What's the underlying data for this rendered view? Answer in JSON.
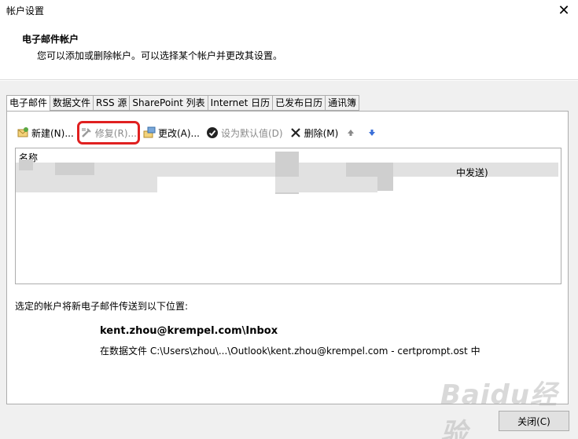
{
  "window": {
    "title": "帐户设置"
  },
  "header": {
    "title": "电子邮件帐户",
    "subtitle": "您可以添加或删除帐户。可以选择某个帐户并更改其设置。"
  },
  "tabs": [
    {
      "label": "电子邮件"
    },
    {
      "label": "数据文件"
    },
    {
      "label": "RSS 源"
    },
    {
      "label": "SharePoint 列表"
    },
    {
      "label": "Internet 日历"
    },
    {
      "label": "已发布日历"
    },
    {
      "label": "通讯簿"
    }
  ],
  "toolbar": {
    "new_label": "新建(N)...",
    "repair_label": "修复(R)...",
    "change_label": "更改(A)...",
    "default_label": "设为默认值(D)",
    "delete_label": "删除(M)"
  },
  "accounts_list": {
    "column_name": "名称",
    "row_tail": "中发送)"
  },
  "delivery": {
    "label": "选定的帐户将新电子邮件传送到以下位置:",
    "address": "kent.zhou@krempel.com\\Inbox",
    "path": "在数据文件 C:\\Users\\zhou\\...\\Outlook\\kent.zhou@krempel.com - certprompt.ost 中"
  },
  "footer": {
    "close_label": "关闭(C)"
  },
  "watermark": {
    "text": "Baidu经验"
  },
  "colors": {
    "highlight": "#e02020",
    "disabled_text": "#8a8a8a",
    "arrow_blue": "#3a6fd8"
  },
  "icons": [
    "new-icon",
    "repair-icon",
    "change-icon",
    "default-check-icon",
    "delete-x-icon",
    "arrow-up-icon",
    "arrow-down-icon",
    "close-icon"
  ]
}
